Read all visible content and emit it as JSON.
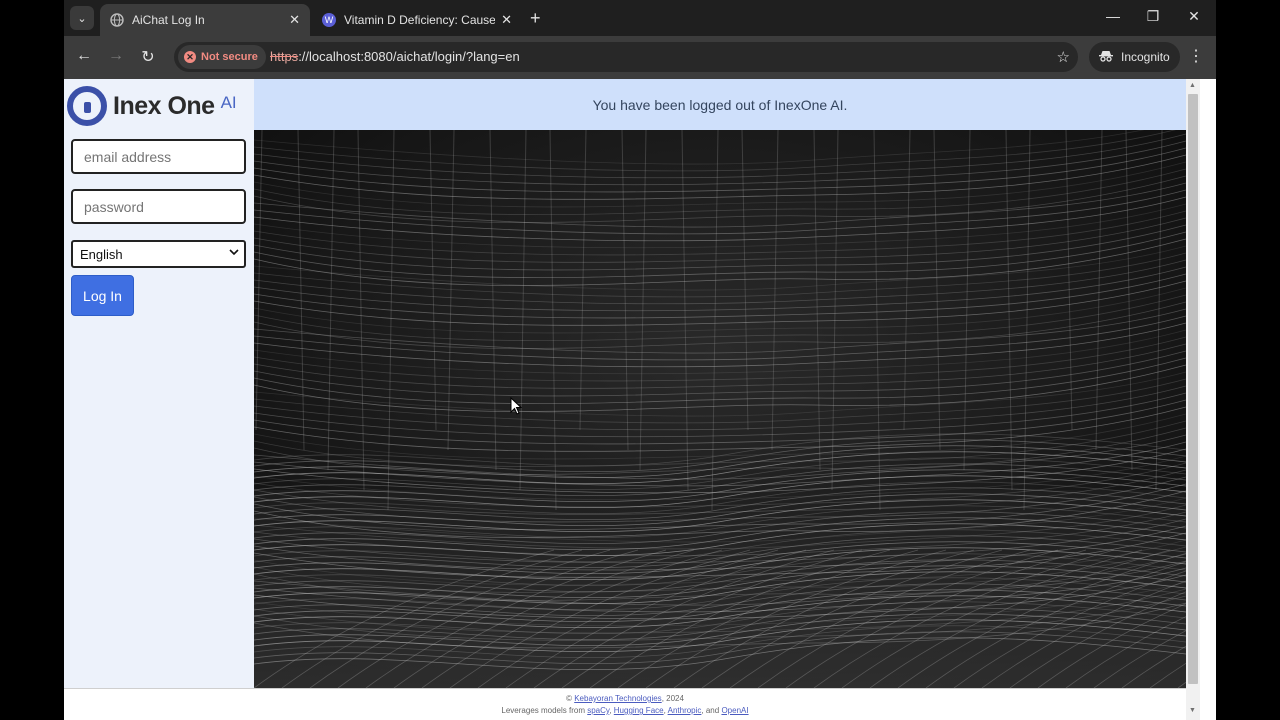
{
  "browser": {
    "tabs": [
      {
        "title": "AiChat Log In",
        "active": true
      },
      {
        "title": "Vitamin D Deficiency: Causes, S",
        "active": false
      }
    ],
    "address": {
      "security_label": "Not secure",
      "url_scheme": "https",
      "url_rest": "://localhost:8080/aichat/login/?lang=en"
    },
    "profile_label": "Incognito"
  },
  "sidebar": {
    "logo_text": "Inex One",
    "logo_suffix": "AI",
    "email_placeholder": "email address",
    "password_placeholder": "password",
    "language_selected": "English",
    "login_label": "Log In"
  },
  "banner": {
    "message": "You have been logged out of InexOne AI."
  },
  "footer": {
    "copyright_prefix": "©",
    "company": "Kebayoran Technologies",
    "year": ", 2024",
    "leverages_prefix": "Leverages models from",
    "providers": [
      "spaCy",
      "Hugging Face",
      "Anthropic"
    ],
    "and_word": "and",
    "last_provider": "OpenAI"
  },
  "colors": {
    "accent": "#3f6fe2",
    "banner_bg": "#cfe0fb",
    "sidebar_bg": "#edf2fb",
    "logo_blue": "#3b50a8"
  }
}
